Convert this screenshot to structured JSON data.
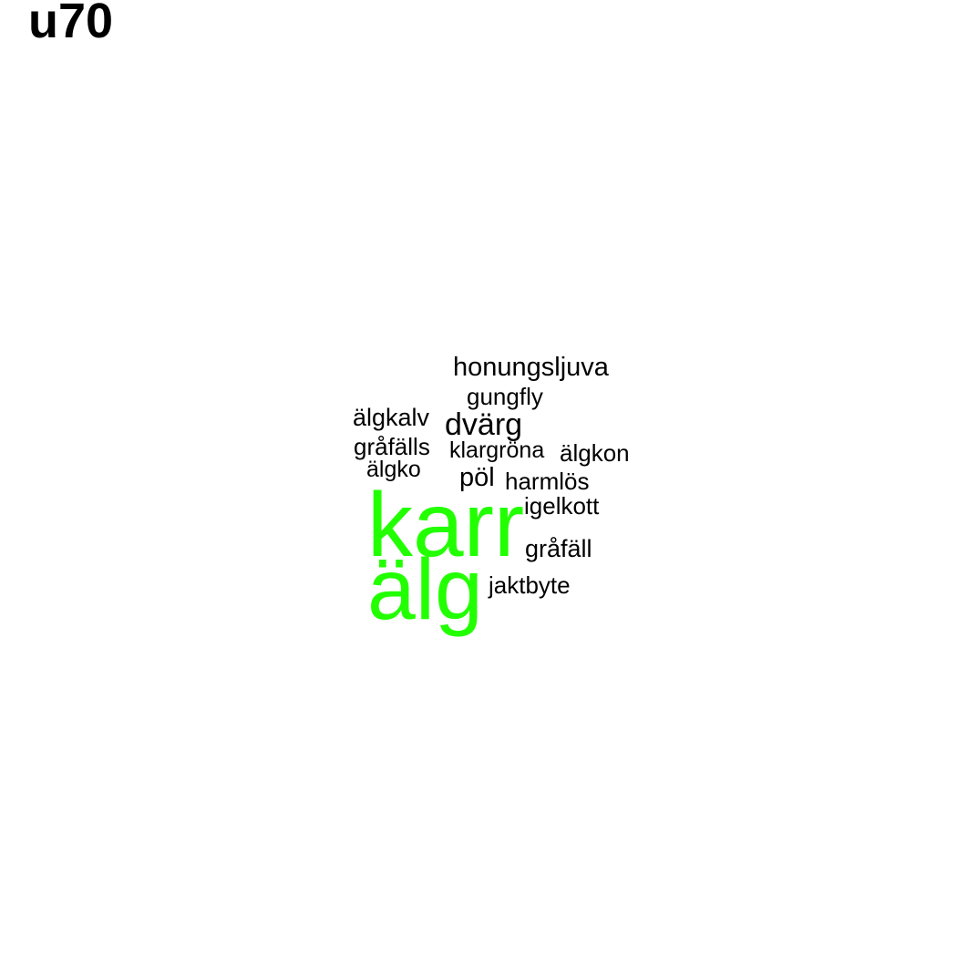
{
  "title": "u70",
  "colors": {
    "highlight": "#22ff00",
    "normal": "#000000",
    "background": "#ffffff"
  },
  "words": [
    {
      "text": "honungsljuva",
      "highlight": false
    },
    {
      "text": "gungfly",
      "highlight": false
    },
    {
      "text": "älgkalv",
      "highlight": false
    },
    {
      "text": "dvärg",
      "highlight": false
    },
    {
      "text": "gråfälls",
      "highlight": false
    },
    {
      "text": "klargröna",
      "highlight": false
    },
    {
      "text": "älgkon",
      "highlight": false
    },
    {
      "text": "älgko",
      "highlight": false
    },
    {
      "text": "pöl",
      "highlight": false
    },
    {
      "text": "harmlös",
      "highlight": false
    },
    {
      "text": "igelkott",
      "highlight": false
    },
    {
      "text": "karr",
      "highlight": true
    },
    {
      "text": "gråfäll",
      "highlight": false
    },
    {
      "text": "älg",
      "highlight": true
    },
    {
      "text": "jaktbyte",
      "highlight": false
    }
  ]
}
